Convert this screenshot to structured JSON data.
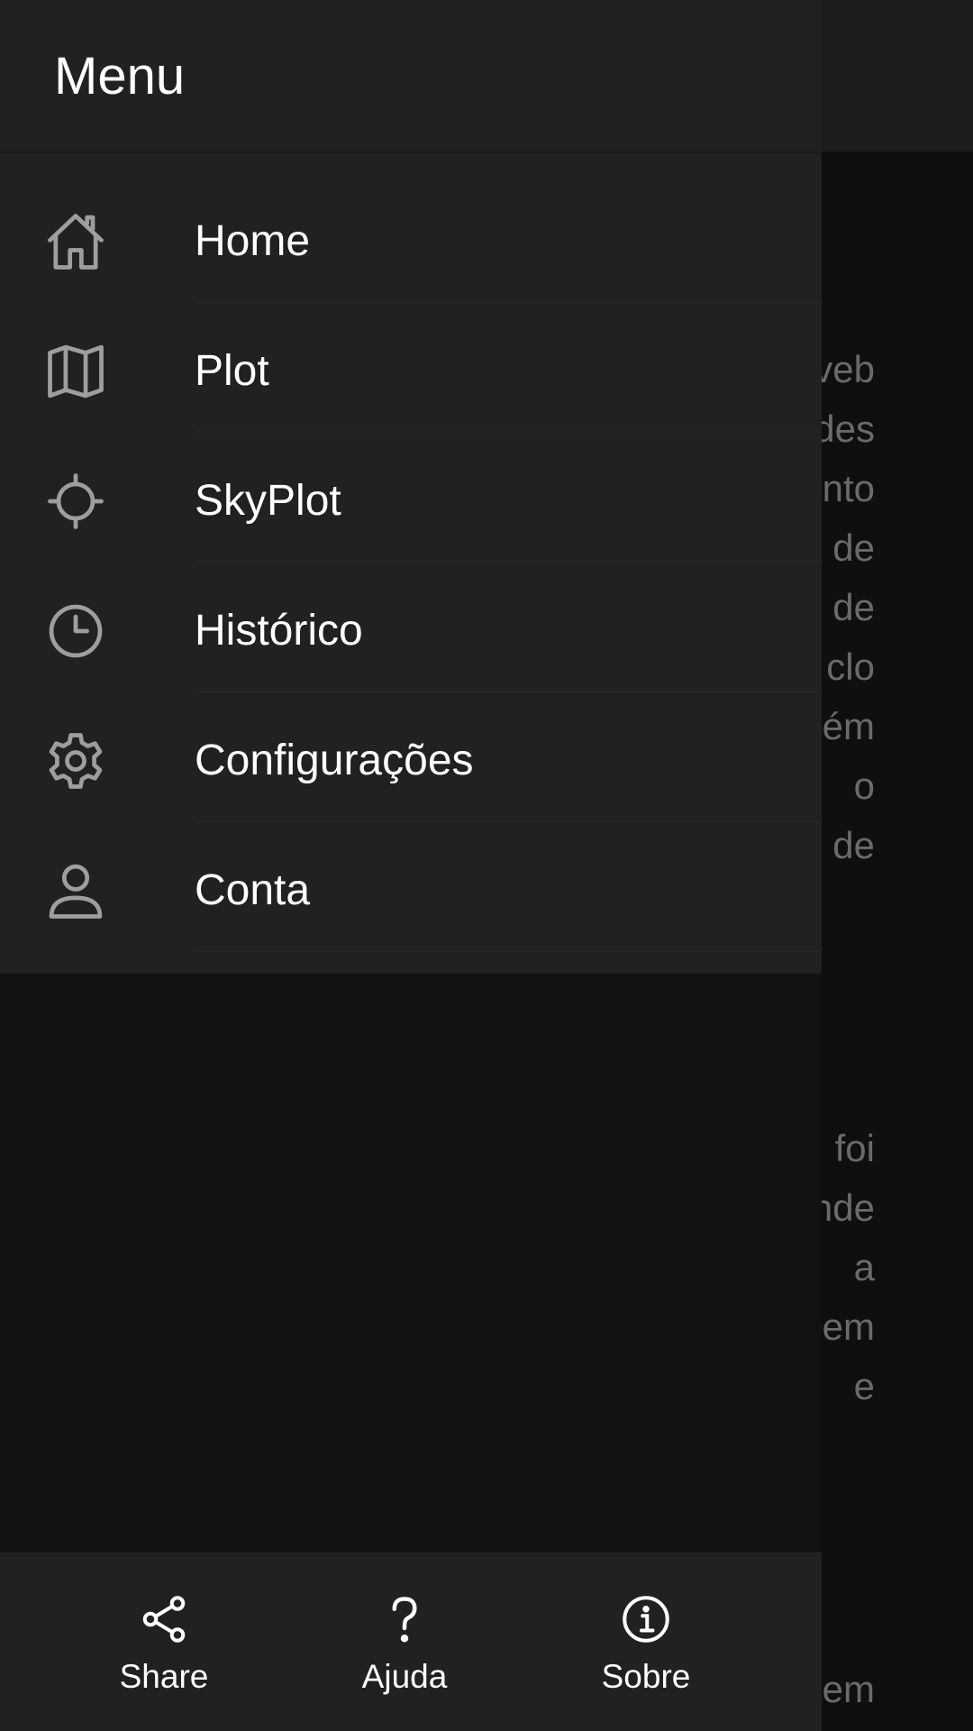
{
  "drawer": {
    "title": "Menu",
    "items": [
      {
        "label": "Home",
        "icon": "home-icon"
      },
      {
        "label": "Plot",
        "icon": "map-icon"
      },
      {
        "label": "SkyPlot",
        "icon": "crosshair-icon"
      },
      {
        "label": "Histórico",
        "icon": "clock-icon"
      },
      {
        "label": "Configurações",
        "icon": "gear-icon"
      },
      {
        "label": "Conta",
        "icon": "user-icon"
      }
    ]
  },
  "bottom_actions": [
    {
      "label": "Share",
      "icon": "share-icon"
    },
    {
      "label": "Ajuda",
      "icon": "question-mark-icon"
    },
    {
      "label": "Sobre",
      "icon": "info-icon"
    }
  ],
  "background_text": {
    "block1": [
      "veb",
      "des",
      "nto",
      "de",
      "de",
      "clo",
      "ém",
      "o",
      "de"
    ],
    "block2": [
      "foi",
      "nde",
      "a",
      "em",
      "e"
    ],
    "bottom": "em"
  },
  "colors": {
    "drawer": "#212121",
    "scrim": "#0f0f0f",
    "icon": "#9e9e9e",
    "text": "#ffffff",
    "background_text": "#6a6a6a"
  }
}
